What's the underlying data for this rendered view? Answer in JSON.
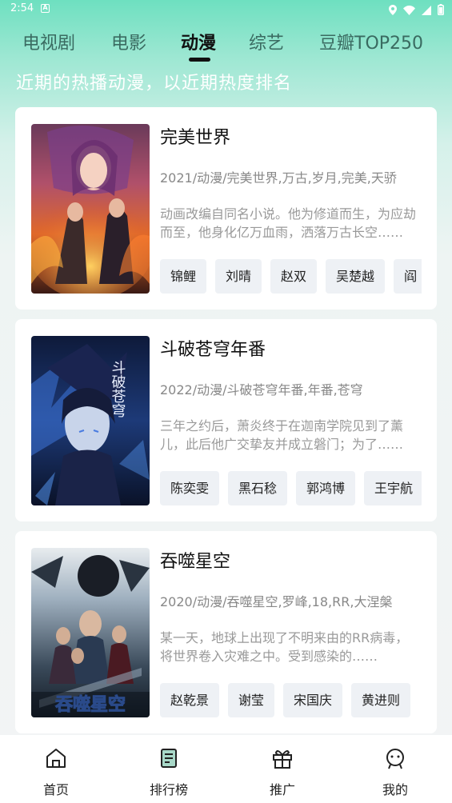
{
  "status_bar": {
    "time": "2:54",
    "notification_letter": "A"
  },
  "tabs": [
    {
      "label": "电视剧"
    },
    {
      "label": "电影"
    },
    {
      "label": "动漫"
    },
    {
      "label": "综艺"
    },
    {
      "label": "豆瓣TOP250"
    }
  ],
  "active_tab": "动漫",
  "subtitle": "近期的热播动漫，以近期热度排名",
  "cards": [
    {
      "title": "完美世界",
      "meta": "2021/动漫/完美世界,万古,岁月,完美,天骄",
      "description": "动画改编自同名小说。他为修道而生，为应劫而至，他身化亿万血雨，洒落万古长空……",
      "cast": [
        "锦鲤",
        "刘晴",
        "赵双",
        "吴楚越",
        "阎"
      ]
    },
    {
      "title": "斗破苍穹年番",
      "meta": "2022/动漫/斗破苍穹年番,年番,苍穹",
      "description": "三年之约后，萧炎终于在迦南学院见到了薰儿，此后他广交挚友并成立磐门；为了……",
      "cast": [
        "陈奕雯",
        "黑石稔",
        "郭鸿博",
        "王宇航"
      ]
    },
    {
      "title": "吞噬星空",
      "meta": "2020/动漫/吞噬星空,罗峰,18,RR,大涅槃",
      "description": "某一天，地球上出现了不明来由的RR病毒，将世界卷入灾难之中。受到感染的……",
      "cast": [
        "赵乾景",
        "谢莹",
        "宋国庆",
        "黄进则"
      ]
    }
  ],
  "poster_texts": {
    "card2": "斗破苍穹",
    "card3": "吞噬星空"
  },
  "bottom_nav": [
    {
      "label": "首页",
      "icon": "home-icon"
    },
    {
      "label": "排行榜",
      "icon": "ranking-icon"
    },
    {
      "label": "推广",
      "icon": "gift-icon"
    },
    {
      "label": "我的",
      "icon": "profile-icon"
    }
  ],
  "colors": {
    "accent": "#6ee0c0",
    "subtitle": "#ffffff",
    "tag_bg": "#eef1f5"
  }
}
